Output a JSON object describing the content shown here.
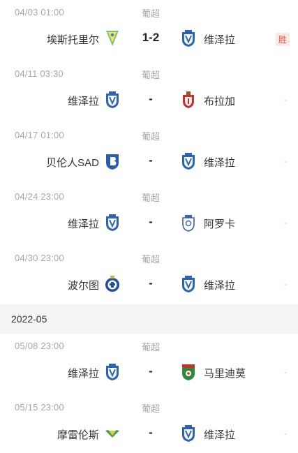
{
  "league": "葡超",
  "month_label": "2022-05",
  "matches": [
    {
      "date": "04/03  01:00",
      "league": "葡超",
      "home": "埃斯托里尔",
      "home_logo": "estoril-crest-icon",
      "score": "1-2",
      "away": "维泽拉",
      "away_logo": "vizela-crest-icon",
      "result": "胜"
    },
    {
      "date": "04/11  03:30",
      "league": "葡超",
      "home": "维泽拉",
      "home_logo": "vizela-crest-icon",
      "score": "-",
      "away": "布拉加",
      "away_logo": "braga-crest-icon",
      "result": "-"
    },
    {
      "date": "04/17  01:00",
      "league": "葡超",
      "home": "贝伦人SAD",
      "home_logo": "belenenses-crest-icon",
      "score": "-",
      "away": "维泽拉",
      "away_logo": "vizela-crest-icon",
      "result": "-"
    },
    {
      "date": "04/24  23:00",
      "league": "葡超",
      "home": "维泽拉",
      "home_logo": "vizela-crest-icon",
      "score": "-",
      "away": "阿罗卡",
      "away_logo": "arouca-crest-icon",
      "result": "-"
    },
    {
      "date": "04/30  23:00",
      "league": "葡超",
      "home": "波尔图",
      "home_logo": "porto-crest-icon",
      "score": "-",
      "away": "维泽拉",
      "away_logo": "vizela-crest-icon",
      "result": "-"
    },
    {
      "date": "05/08  23:00",
      "league": "葡超",
      "home": "维泽拉",
      "home_logo": "vizela-crest-icon",
      "score": "-",
      "away": "马里迪莫",
      "away_logo": "maritimo-crest-icon",
      "result": "-"
    },
    {
      "date": "05/15  23:00",
      "league": "葡超",
      "home": "摩雷伦斯",
      "home_logo": "moreirense-crest-icon",
      "score": "-",
      "away": "维泽拉",
      "away_logo": "vizela-crest-icon",
      "result": "-"
    }
  ],
  "colors": {
    "win_text": "#e8533f",
    "win_bg": "#fde8e6",
    "meta_gray": "#a8a8a8",
    "divider_bg": "#f4f5f7"
  }
}
